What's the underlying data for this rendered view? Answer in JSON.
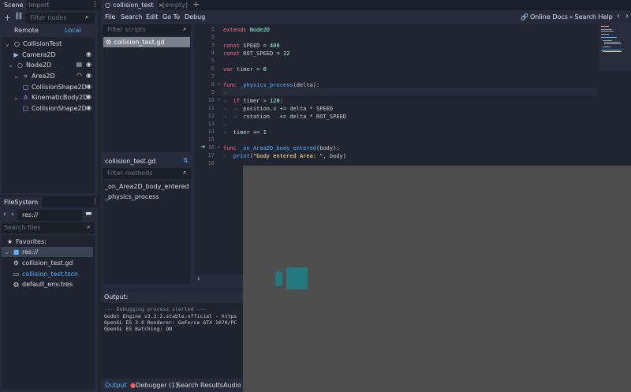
{
  "scene_dock": {
    "tabs": [
      "Scene",
      "Import"
    ],
    "filter_placeholder": "Filter nodes",
    "modes": [
      "Remote",
      "Local"
    ],
    "nodes": [
      {
        "label": "CollisionTest",
        "depth": 0
      },
      {
        "label": "Camera2D",
        "depth": 1
      },
      {
        "label": "Node2D",
        "depth": 1
      },
      {
        "label": "Area2D",
        "depth": 2
      },
      {
        "label": "CollisionShape2D",
        "depth": 3
      },
      {
        "label": "KinematicBody2D",
        "depth": 2
      },
      {
        "label": "CollisionShape2D",
        "depth": 3
      }
    ]
  },
  "filesystem_dock": {
    "tab": "FileSystem",
    "path": "res://",
    "search_placeholder": "Search files",
    "favorites_label": "Favorites:",
    "items": [
      "res://",
      "collision_test.gd",
      "collision_test.tscn",
      "default_env.tres"
    ]
  },
  "editor_tabs": [
    "collision_test",
    "[empty]"
  ],
  "menu": [
    "File",
    "Search",
    "Edit",
    "Go To",
    "Debug"
  ],
  "help_buttons": [
    "Online Docs",
    "Search Help"
  ],
  "script_panel": {
    "filter_scripts_placeholder": "Filter scripts",
    "scripts": [
      "collision_test.gd"
    ],
    "current_script": "collision_test.gd",
    "filter_methods_placeholder": "Filter methods",
    "methods": [
      "_on_Area2D_body_entered",
      "_physics_process"
    ]
  },
  "code": {
    "line_numbers": [
      "1",
      "2",
      "3",
      "4",
      "5",
      "6",
      "7",
      "8",
      "9",
      "10",
      "11",
      "12",
      "13",
      "14",
      "15",
      "16",
      "17",
      "18"
    ]
  },
  "output": {
    "title": "Output:",
    "lines": [
      "--- Debugging process started ---",
      "Godot Engine v3.2.2.stable.official - https",
      "OpenGL ES 3.0 Renderer: GeForce GTX 1070/PC",
      "OpenGL ES Batching: ON"
    ]
  },
  "bottom_tabs": [
    "Output",
    "Debugger (1)",
    "Search Results",
    "Audio"
  ],
  "colors": {
    "game_bg": "#4d4d4d",
    "sprite": "#24787f",
    "accent": "#57b3ff"
  }
}
